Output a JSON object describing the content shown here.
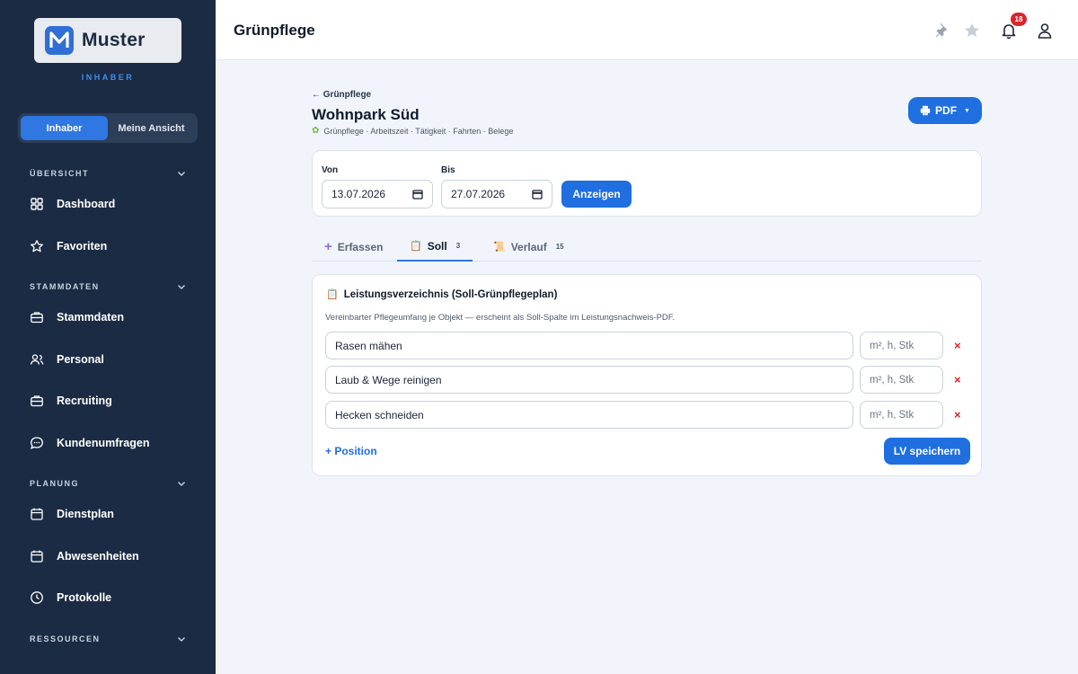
{
  "sidebar": {
    "logo_text": "Muster",
    "role": "INHABER",
    "toggle": {
      "active": "Inhaber",
      "other": "Meine Ansicht"
    },
    "sections": {
      "uebersicht": "ÜBERSICHT",
      "stammdaten": "STAMMDATEN",
      "planung": "PLANUNG",
      "ressourcen": "RESSOURCEN"
    },
    "items": {
      "dashboard": "Dashboard",
      "favoriten": "Favoriten",
      "stammdaten": "Stammdaten",
      "personal": "Personal",
      "recruiting": "Recruiting",
      "kundenumfragen": "Kundenumfragen",
      "dienstplan": "Dienstplan",
      "abwesenheiten": "Abwesenheiten",
      "protokolle": "Protokolle"
    }
  },
  "header": {
    "title": "Grünpflege",
    "notification_count": "18"
  },
  "main": {
    "back_link": "← Grünpflege",
    "title": "Wohnpark Süd",
    "subnav": "Grünpflege · Arbeitszeit · Tätigkeit · Fahrten · Belege",
    "pdf_label": "PDF",
    "filter": {
      "from_label": "Von",
      "from_value": "13.07.2026",
      "to_label": "Bis",
      "to_value": "27.07.2026",
      "show_label": "Anzeigen"
    },
    "tabs": {
      "erfassen": "Erfassen",
      "soll": "Soll",
      "soll_count": "3",
      "verlauf": "Verlauf",
      "verlauf_count": "15"
    },
    "lv": {
      "title": "Leistungsverzeichnis (Soll-Grünpflegeplan)",
      "description": "Vereinbarter Pflegeumfang je Objekt — erscheint als Soll-Spalte im Leistungsnachweis-PDF.",
      "rows": [
        {
          "name": "Rasen mähen",
          "unit_placeholder": "m², h, Stk"
        },
        {
          "name": "Laub & Wege reinigen",
          "unit_placeholder": "m², h, Stk"
        },
        {
          "name": "Hecken schneiden",
          "unit_placeholder": "m², h, Stk"
        }
      ],
      "delete_symbol": "×",
      "add_label": "+ Position",
      "save_label": "LV speichern"
    }
  },
  "colors": {
    "sidebar_bg": "#1b2b44",
    "accent": "#1f6fe0",
    "danger": "#d8262e"
  }
}
